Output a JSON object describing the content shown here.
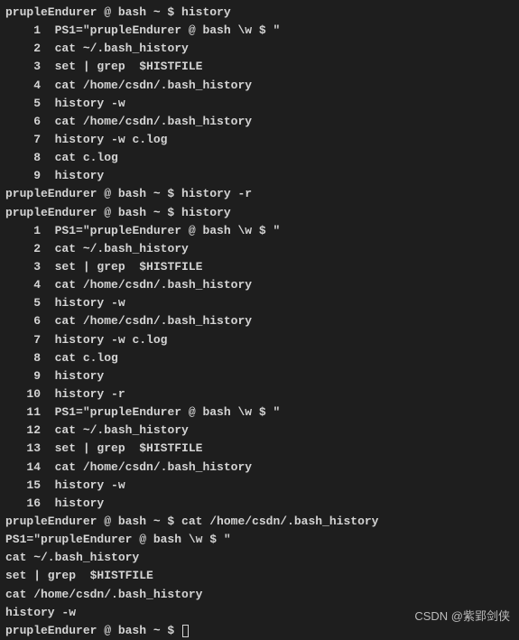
{
  "prompt": "prupleEndurer @ bash ~ $ ",
  "commands": {
    "c1": "history",
    "c2": "history -r",
    "c3": "history",
    "c4": "cat /home/csdn/.bash_history"
  },
  "history_block_1": [
    {
      "n": "1",
      "cmd": "PS1=\"prupleEndurer @ bash \\w $ \""
    },
    {
      "n": "2",
      "cmd": "cat ~/.bash_history"
    },
    {
      "n": "3",
      "cmd": "set | grep  $HISTFILE"
    },
    {
      "n": "4",
      "cmd": "cat /home/csdn/.bash_history"
    },
    {
      "n": "5",
      "cmd": "history -w"
    },
    {
      "n": "6",
      "cmd": "cat /home/csdn/.bash_history"
    },
    {
      "n": "7",
      "cmd": "history -w c.log"
    },
    {
      "n": "8",
      "cmd": "cat c.log"
    },
    {
      "n": "9",
      "cmd": "history"
    }
  ],
  "history_block_2": [
    {
      "n": "1",
      "cmd": "PS1=\"prupleEndurer @ bash \\w $ \""
    },
    {
      "n": "2",
      "cmd": "cat ~/.bash_history"
    },
    {
      "n": "3",
      "cmd": "set | grep  $HISTFILE"
    },
    {
      "n": "4",
      "cmd": "cat /home/csdn/.bash_history"
    },
    {
      "n": "5",
      "cmd": "history -w"
    },
    {
      "n": "6",
      "cmd": "cat /home/csdn/.bash_history"
    },
    {
      "n": "7",
      "cmd": "history -w c.log"
    },
    {
      "n": "8",
      "cmd": "cat c.log"
    },
    {
      "n": "9",
      "cmd": "history"
    },
    {
      "n": "10",
      "cmd": "history -r"
    },
    {
      "n": "11",
      "cmd": "PS1=\"prupleEndurer @ bash \\w $ \""
    },
    {
      "n": "12",
      "cmd": "cat ~/.bash_history"
    },
    {
      "n": "13",
      "cmd": "set | grep  $HISTFILE"
    },
    {
      "n": "14",
      "cmd": "cat /home/csdn/.bash_history"
    },
    {
      "n": "15",
      "cmd": "history -w"
    },
    {
      "n": "16",
      "cmd": "history"
    }
  ],
  "cat_output": [
    "PS1=\"prupleEndurer @ bash \\w $ \"",
    "cat ~/.bash_history",
    "set | grep  $HISTFILE",
    "cat /home/csdn/.bash_history",
    "history -w"
  ],
  "watermark": "CSDN @紫郢剑侠"
}
